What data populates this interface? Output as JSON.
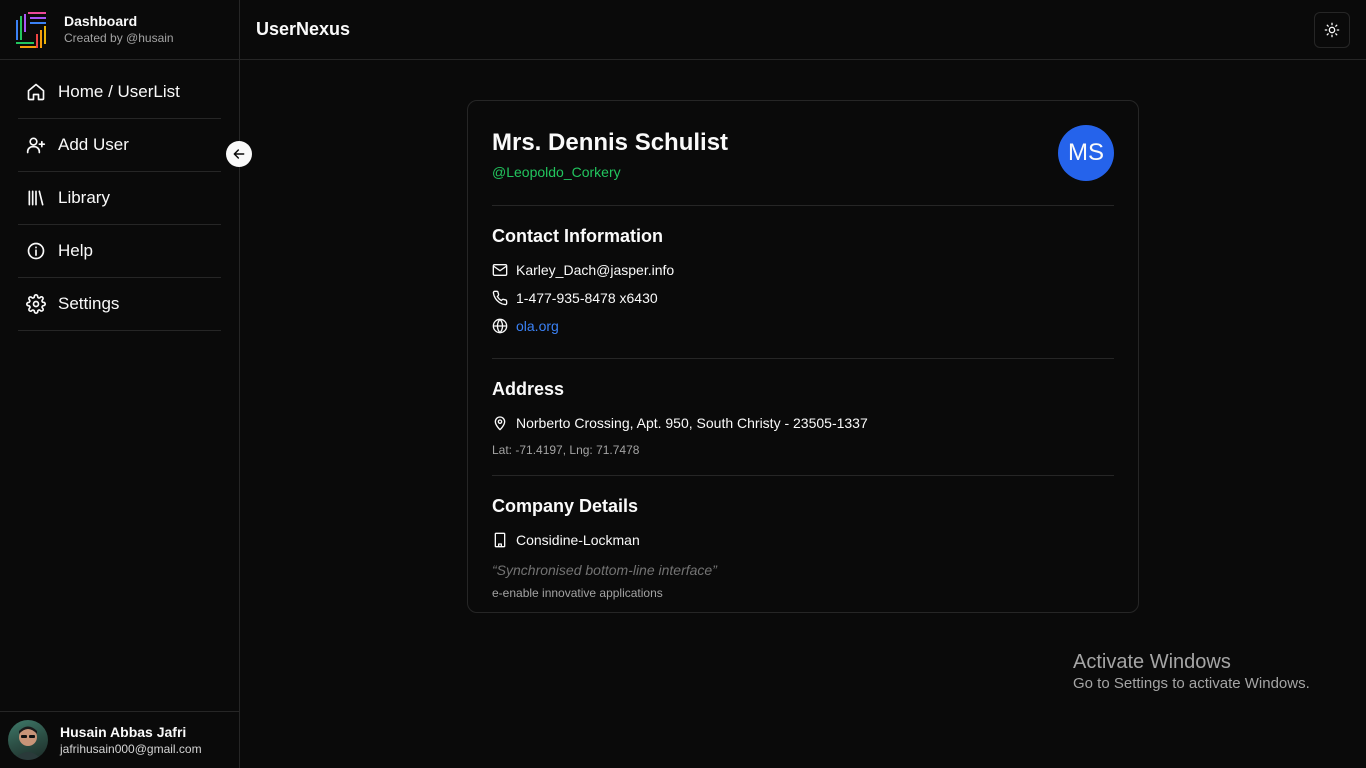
{
  "brand": {
    "title": "Dashboard",
    "subtitle": "Created by @husain"
  },
  "nav": {
    "items": [
      {
        "label": "Home / UserList",
        "icon": "home-icon"
      },
      {
        "label": "Add User",
        "icon": "user-plus-icon"
      },
      {
        "label": "Library",
        "icon": "library-icon"
      },
      {
        "label": "Help",
        "icon": "info-icon"
      },
      {
        "label": "Settings",
        "icon": "gear-icon"
      }
    ]
  },
  "sidebar_user": {
    "name": "Husain Abbas Jafri",
    "email": "jafrihusain000@gmail.com"
  },
  "topbar": {
    "title": "UserNexus",
    "theme_icon": "sun-icon"
  },
  "profile": {
    "name": "Mrs. Dennis Schulist",
    "username": "@Leopoldo_Corkery",
    "initials": "MS",
    "contact": {
      "title": "Contact Information",
      "email": "Karley_Dach@jasper.info",
      "phone": "1-477-935-8478 x6430",
      "website": "ola.org"
    },
    "address": {
      "title": "Address",
      "line": "Norberto Crossing, Apt. 950, South Christy - 23505-1337",
      "geo": "Lat: -71.4197, Lng: 71.7478"
    },
    "company": {
      "title": "Company Details",
      "name": "Considine-Lockman",
      "catchphrase": "“Synchronised bottom-line interface”",
      "bs": "e-enable innovative applications"
    }
  },
  "watermark": {
    "line1": "Activate Windows",
    "line2": "Go to Settings to activate Windows."
  },
  "colors": {
    "accent_blue": "#2563eb",
    "link_blue": "#3b82f6",
    "handle_green": "#22c55e",
    "background": "#0a0a0a",
    "border": "#262626"
  }
}
